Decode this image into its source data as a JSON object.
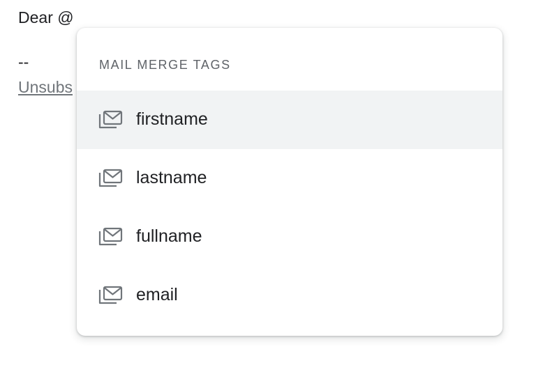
{
  "editor": {
    "greeting": "Dear @",
    "separator": "--",
    "unsubscribe": "Unsubs"
  },
  "popup": {
    "header": "MAIL MERGE TAGS",
    "items": [
      {
        "label": "firstname",
        "icon": "mail-merge-icon",
        "highlighted": true
      },
      {
        "label": "lastname",
        "icon": "mail-merge-icon",
        "highlighted": false
      },
      {
        "label": "fullname",
        "icon": "mail-merge-icon",
        "highlighted": false
      },
      {
        "label": "email",
        "icon": "mail-merge-icon",
        "highlighted": false
      }
    ]
  },
  "colors": {
    "text": "#202124",
    "muted": "#5f6368",
    "link": "#70757a",
    "highlight": "#f1f3f4",
    "icon": "#70757a"
  }
}
